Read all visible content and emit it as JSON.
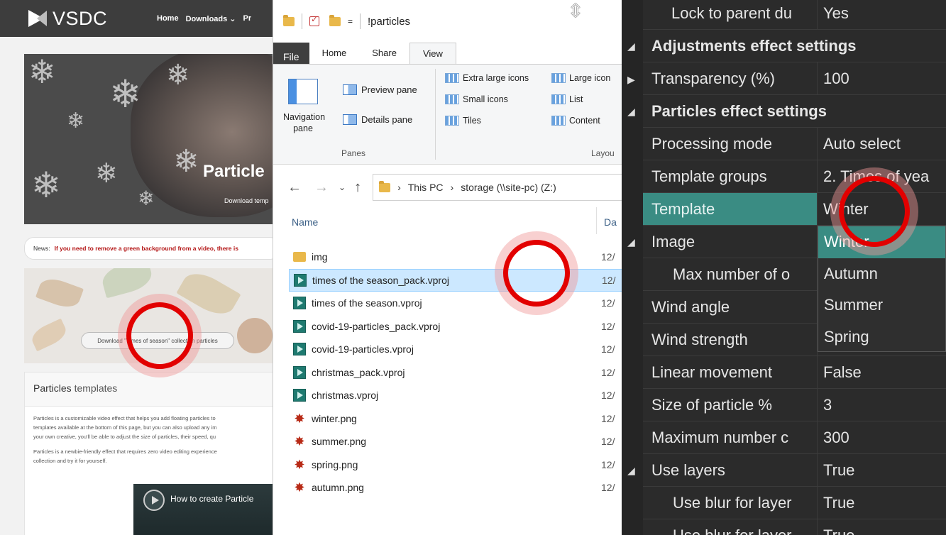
{
  "site": {
    "logo": "VSDC",
    "nav": [
      "Home",
      "Downloads ⌄",
      "Pr"
    ],
    "hero_title": "Particle",
    "hero_sub": "Download temp",
    "news_label": "News:",
    "news_text": "If you need to remove a green background from a video, there is",
    "download_button": "Download \"Times of season\" collection particles",
    "section_title_a": "Particles",
    "section_title_b": "templates",
    "para1_l1": "Particles is a customizable video effect that helps you add floating particles to",
    "para1_l2": "templates available at the bottom of this page, but you can also upload any im",
    "para1_l3": "your own creative, you'll be able to adjust the size of particles, their speed, qu",
    "para2_l1": "Particles is a newbie-friendly effect that requires zero video editing experience",
    "para2_l2": "collection and try it for yourself.",
    "video_title": "How to create Particle"
  },
  "explorer": {
    "window_title": "!particles",
    "tabs": [
      "File",
      "Home",
      "Share",
      "View"
    ],
    "active_tab": "View",
    "panes": {
      "navigation_pane": "Navigation pane",
      "preview_pane": "Preview pane",
      "details_pane": "Details pane",
      "group": "Panes"
    },
    "layout": {
      "extra_large": "Extra large icons",
      "large": "Large icon",
      "small": "Small icons",
      "list": "List",
      "tiles": "Tiles",
      "content": "Content",
      "group": "Layou"
    },
    "address": {
      "this_pc": "This PC",
      "drive": "storage (\\\\site-pc) (Z:)"
    },
    "columns": {
      "name": "Name",
      "date": "Da"
    },
    "files": [
      {
        "name": "img",
        "type": "folder",
        "date": "12/"
      },
      {
        "name": "times of the season_pack.vproj",
        "type": "vproj",
        "date": "12/",
        "selected": true
      },
      {
        "name": "times of the season.vproj",
        "type": "vproj",
        "date": "12/"
      },
      {
        "name": "covid-19-particles_pack.vproj",
        "type": "vproj",
        "date": "12/"
      },
      {
        "name": "covid-19-particles.vproj",
        "type": "vproj",
        "date": "12/"
      },
      {
        "name": "christmas_pack.vproj",
        "type": "vproj",
        "date": "12/"
      },
      {
        "name": "christmas.vproj",
        "type": "vproj",
        "date": "12/"
      },
      {
        "name": "winter.png",
        "type": "png",
        "date": "12/"
      },
      {
        "name": "summer.png",
        "type": "png",
        "date": "12/"
      },
      {
        "name": "spring.png",
        "type": "png",
        "date": "12/"
      },
      {
        "name": "autumn.png",
        "type": "png",
        "date": "12/"
      }
    ]
  },
  "props": {
    "lock_to_parent": {
      "key": "Lock to parent du",
      "value": "Yes"
    },
    "adjustments_header": "Adjustments effect settings",
    "transparency": {
      "key": "Transparency (%)",
      "value": "100"
    },
    "particles_header": "Particles effect settings",
    "processing_mode": {
      "key": "Processing mode",
      "value": "Auto select"
    },
    "template_groups": {
      "key": "Template groups",
      "value": "2. Times of yea"
    },
    "template": {
      "key": "Template",
      "value": "Winter"
    },
    "image": {
      "key": "Image"
    },
    "max_number_objects": {
      "key": "Max number of o"
    },
    "wind_angle": {
      "key": "Wind angle"
    },
    "wind_strength": {
      "key": "Wind strength"
    },
    "linear_movement": {
      "key": "Linear movement",
      "value": "False"
    },
    "size_of_particle": {
      "key": "Size of particle %",
      "value": "3"
    },
    "maximum_number": {
      "key": "Maximum number c",
      "value": "300"
    },
    "use_layers": {
      "key": "Use layers",
      "value": "True"
    },
    "use_blur_1": {
      "key": "Use blur for layer",
      "value": "True"
    },
    "use_blur_2": {
      "key": "Use blur for layer",
      "value": "True"
    },
    "dropdown_options": [
      "Winter",
      "Autumn",
      "Summer",
      "Spring"
    ],
    "dropdown_selected": "Winter"
  },
  "colors": {
    "accent_teal": "#3a8c83",
    "click_marker": "#e20000",
    "selection_blue": "#cce8ff",
    "news_red": "#b31313"
  }
}
